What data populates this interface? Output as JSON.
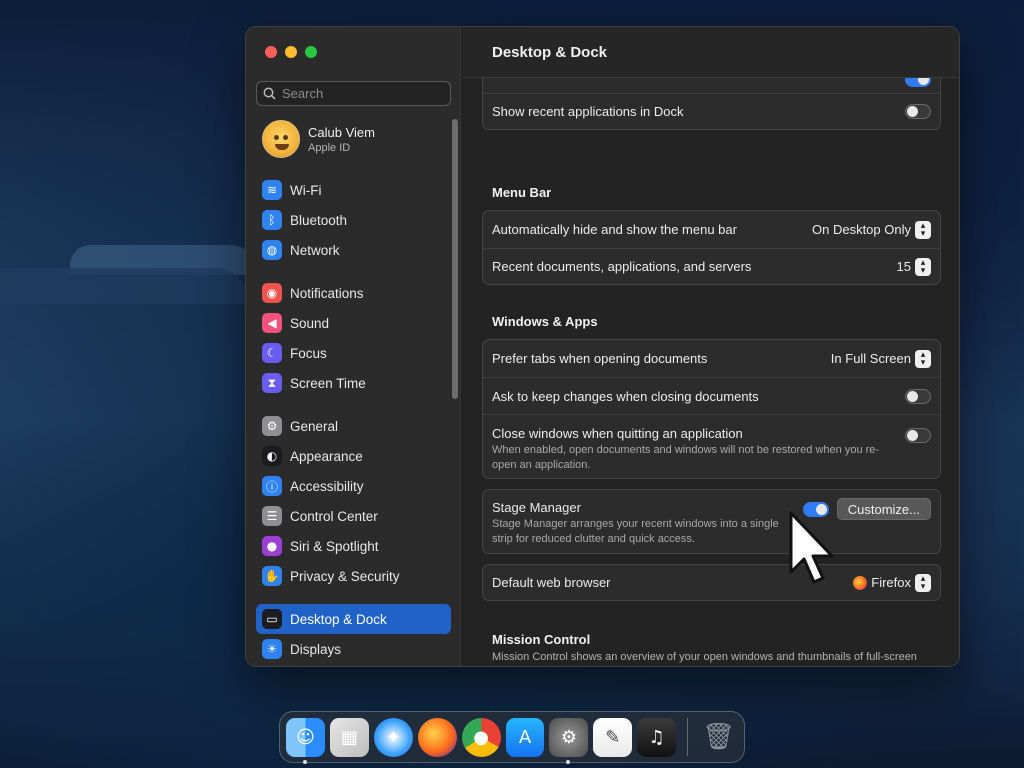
{
  "window": {
    "title": "Desktop & Dock"
  },
  "sidebar": {
    "search_placeholder": "Search",
    "account": {
      "name": "Calub Viem",
      "subtitle": "Apple ID"
    },
    "groups": [
      [
        {
          "label": "Wi-Fi",
          "icon": "wifi-icon",
          "color": "#2f83f0"
        },
        {
          "label": "Bluetooth",
          "icon": "bluetooth-icon",
          "color": "#2f83f0"
        },
        {
          "label": "Network",
          "icon": "globe-icon",
          "color": "#2f83f0"
        }
      ],
      [
        {
          "label": "Notifications",
          "icon": "bell-icon",
          "color": "#f0524f"
        },
        {
          "label": "Sound",
          "icon": "speaker-icon",
          "color": "#f0527a"
        },
        {
          "label": "Focus",
          "icon": "moon-icon",
          "color": "#6a5cf0"
        },
        {
          "label": "Screen Time",
          "icon": "hourglass-icon",
          "color": "#6a5cf0"
        }
      ],
      [
        {
          "label": "General",
          "icon": "gear-icon",
          "color": "#8e8e93"
        },
        {
          "label": "Appearance",
          "icon": "appearance-icon",
          "color": "#1c1c1e"
        },
        {
          "label": "Accessibility",
          "icon": "accessibility-icon",
          "color": "#2f83f0"
        },
        {
          "label": "Control Center",
          "icon": "control-center-icon",
          "color": "#8e8e93"
        },
        {
          "label": "Siri & Spotlight",
          "icon": "siri-icon",
          "color": "#9b3fd6"
        },
        {
          "label": "Privacy & Security",
          "icon": "hand-icon",
          "color": "#2f83f0"
        }
      ],
      [
        {
          "label": "Desktop & Dock",
          "icon": "dock-icon",
          "color": "#1c1c1e",
          "active": true
        },
        {
          "label": "Displays",
          "icon": "sun-icon",
          "color": "#2f83f0"
        }
      ]
    ]
  },
  "main": {
    "dock_group": {
      "recent_apps_label": "Show recent applications in Dock",
      "recent_apps_on": false
    },
    "menu_bar": {
      "title": "Menu Bar",
      "autohide_label": "Automatically hide and show the menu bar",
      "autohide_value": "On Desktop Only",
      "recent_docs_label": "Recent documents, applications, and servers",
      "recent_docs_value": "15"
    },
    "windows_apps": {
      "title": "Windows & Apps",
      "prefer_tabs_label": "Prefer tabs when opening documents",
      "prefer_tabs_value": "In Full Screen",
      "ask_keep_label": "Ask to keep changes when closing documents",
      "ask_keep_on": false,
      "close_windows_label": "Close windows when quitting an application",
      "close_windows_desc": "When enabled, open documents and windows will not be restored when you re-open an application.",
      "close_windows_on": false
    },
    "stage_manager": {
      "label": "Stage Manager",
      "desc": "Stage Manager arranges your recent windows into a single strip for reduced clutter and quick access.",
      "on": true,
      "customize_label": "Customize..."
    },
    "browser": {
      "label": "Default web browser",
      "value": "Firefox"
    },
    "mission_control": {
      "title": "Mission Control",
      "desc": "Mission Control shows an overview of your open windows and thumbnails of full-screen applications, all arranged in a unified view."
    }
  },
  "dock": {
    "apps": [
      {
        "name": "Finder",
        "icon": "finder-icon",
        "running": true
      },
      {
        "name": "Launchpad",
        "icon": "launchpad-icon",
        "running": false
      },
      {
        "name": "Safari",
        "icon": "safari-icon",
        "running": false
      },
      {
        "name": "Firefox",
        "icon": "firefox-icon",
        "running": false
      },
      {
        "name": "Chrome",
        "icon": "chrome-icon",
        "running": false
      },
      {
        "name": "App Store",
        "icon": "app-store-icon",
        "running": false
      },
      {
        "name": "System Settings",
        "icon": "system-settings-icon",
        "running": true
      },
      {
        "name": "TextEdit",
        "icon": "textedit-icon",
        "running": false
      },
      {
        "name": "GarageBand",
        "icon": "garageband-icon",
        "running": false
      }
    ],
    "trash": {
      "name": "Trash",
      "icon": "trash-icon"
    }
  },
  "colors": {
    "accent": "#1f63c9",
    "toggle_on": "#2f7cf6"
  }
}
